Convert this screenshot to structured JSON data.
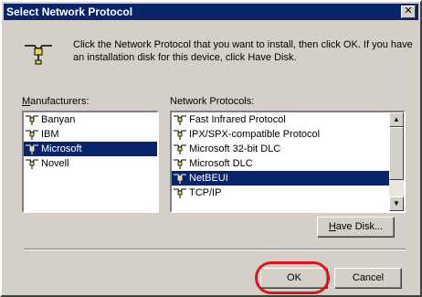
{
  "window": {
    "title": "Select Network Protocol",
    "close_glyph": "✕"
  },
  "intro": {
    "icon": "network-protocol-icon",
    "text": "Click the Network Protocol that you want to install, then click OK. If you have an installation disk for this device, click Have Disk."
  },
  "manufacturers": {
    "label_prefix": "M",
    "label_rest": "anufacturers:",
    "items": [
      {
        "label": "Banyan",
        "selected": false
      },
      {
        "label": "IBM",
        "selected": false
      },
      {
        "label": "Microsoft",
        "selected": true
      },
      {
        "label": "Novell",
        "selected": false
      }
    ]
  },
  "protocols": {
    "label": "Network Protocols:",
    "items": [
      {
        "label": "Fast Infrared Protocol",
        "selected": false
      },
      {
        "label": "IPX/SPX-compatible Protocol",
        "selected": false
      },
      {
        "label": "Microsoft 32-bit DLC",
        "selected": false
      },
      {
        "label": "Microsoft DLC",
        "selected": false
      },
      {
        "label": "NetBEUI",
        "selected": true
      },
      {
        "label": "TCP/IP",
        "selected": false
      }
    ],
    "scroll_up_glyph": "▲",
    "scroll_down_glyph": "▼"
  },
  "buttons": {
    "have_disk_prefix": "H",
    "have_disk_rest": "ave Disk...",
    "ok": "OK",
    "cancel": "Cancel"
  },
  "colors": {
    "title_bar": "#0a246a",
    "selection": "#0a246a",
    "face": "#d4d0c8",
    "annotation_ring": "#e0141e"
  }
}
